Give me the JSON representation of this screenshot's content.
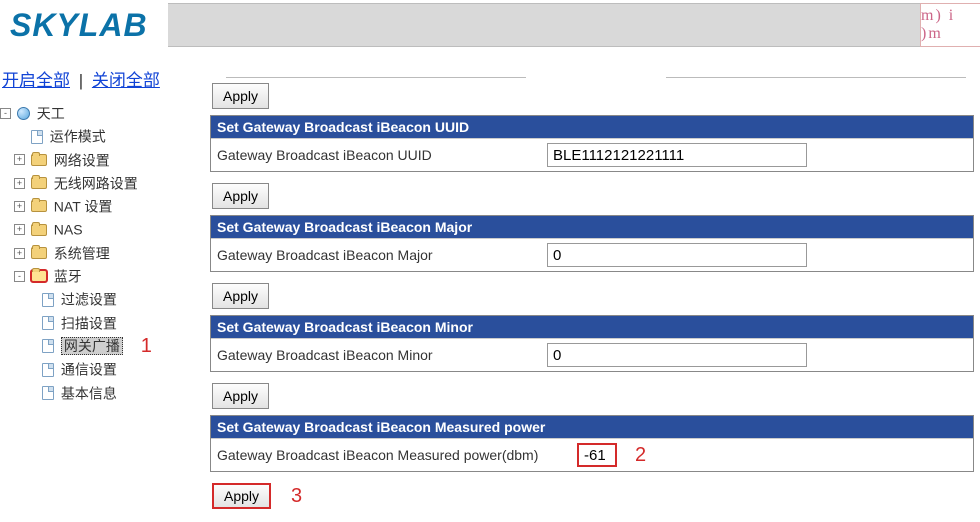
{
  "header": {
    "logo": "SKYLAB",
    "right_badge": "m) i )m"
  },
  "sidebar": {
    "open_all": "开启全部",
    "close_all": "关闭全部",
    "root": "天工",
    "items": [
      {
        "label": "运作模式",
        "icon": "page",
        "exp": ""
      },
      {
        "label": "网络设置",
        "icon": "folder",
        "exp": "+"
      },
      {
        "label": "无线网路设置",
        "icon": "folder",
        "exp": "+"
      },
      {
        "label": "NAT 设置",
        "icon": "folder",
        "exp": "+"
      },
      {
        "label": "NAS",
        "icon": "folder",
        "exp": "+"
      },
      {
        "label": "系统管理",
        "icon": "folder",
        "exp": "+"
      },
      {
        "label": "蓝牙",
        "icon": "folder-open",
        "exp": "-"
      }
    ],
    "bt_children": [
      {
        "label": "过滤设置"
      },
      {
        "label": "扫描设置"
      },
      {
        "label": "网关广播",
        "selected": true
      },
      {
        "label": "通信设置"
      },
      {
        "label": "基本信息"
      }
    ],
    "annotation_1": "1"
  },
  "sections": {
    "apply_label": "Apply",
    "uuid": {
      "title": "Set Gateway Broadcast iBeacon UUID",
      "label": "Gateway Broadcast iBeacon UUID",
      "value": "BLE1112121221111"
    },
    "major": {
      "title": "Set Gateway Broadcast iBeacon Major",
      "label": "Gateway Broadcast iBeacon Major",
      "value": "0"
    },
    "minor": {
      "title": "Set Gateway Broadcast iBeacon Minor",
      "label": "Gateway Broadcast iBeacon Minor",
      "value": "0"
    },
    "power": {
      "title": "Set Gateway Broadcast iBeacon Measured power",
      "label": "Gateway Broadcast iBeacon Measured power(dbm)",
      "value": "-61"
    },
    "annotation_2": "2",
    "annotation_3": "3"
  }
}
